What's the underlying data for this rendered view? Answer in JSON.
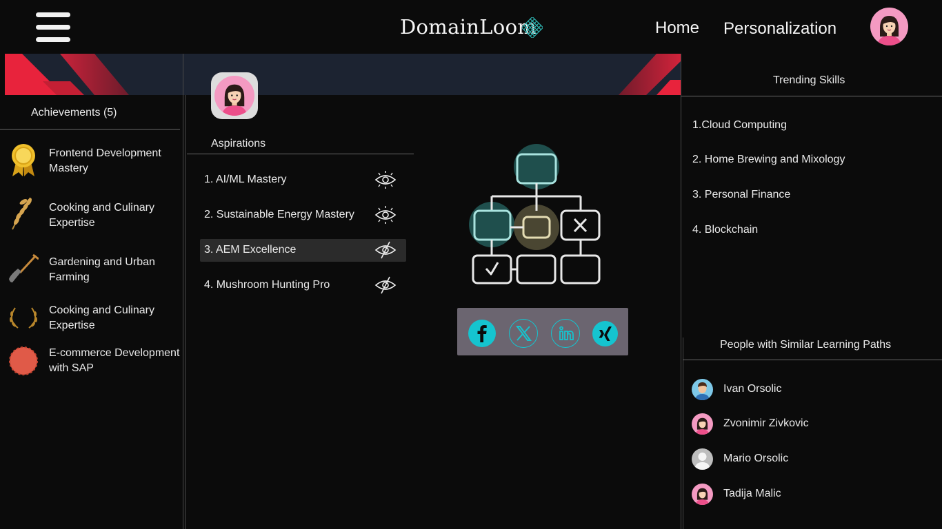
{
  "header": {
    "logo_text": "DomainLoom",
    "nav": {
      "home": "Home",
      "personalization": "Personalization"
    }
  },
  "achievements": {
    "title": "Achievements (5)",
    "items": [
      {
        "label": "Frontend Development Mastery",
        "icon": "gold-ribbon-medal-icon"
      },
      {
        "label": "Cooking and Culinary Expertise",
        "icon": "wheat-icon"
      },
      {
        "label": "Gardening and Urban Farming",
        "icon": "shovel-icon"
      },
      {
        "label": "Cooking and Culinary Expertise",
        "icon": "laurel-wreath-icon"
      },
      {
        "label": "E-commerce Development with SAP",
        "icon": "red-seal-icon"
      }
    ]
  },
  "aspirations": {
    "title": "Aspirations",
    "items": [
      {
        "label": "1. AI/ML Mastery",
        "visibility": "visible"
      },
      {
        "label": "2. Sustainable Energy Mastery",
        "visibility": "visible"
      },
      {
        "label": "3. AEM Excellence",
        "visibility": "hidden",
        "selected": true
      },
      {
        "label": "4. Mushroom Hunting Pro",
        "visibility": "hidden"
      }
    ]
  },
  "social": [
    "facebook-icon",
    "x-twitter-icon",
    "linkedin-icon",
    "xing-icon"
  ],
  "trending": {
    "title": "Trending Skills",
    "items": [
      "1.Cloud Computing",
      "2. Home Brewing and Mixology",
      "3. Personal Finance",
      "4. Blockchain"
    ]
  },
  "people": {
    "title": "People with Similar Learning Paths",
    "items": [
      {
        "name": "Ivan Orsolic",
        "avatar": "male-avatar-blue"
      },
      {
        "name": "Zvonimir Zivkovic",
        "avatar": "female-avatar-pink"
      },
      {
        "name": "Mario Orsolic",
        "avatar": "default-avatar-grey"
      },
      {
        "name": "Tadija Malic",
        "avatar": "female-avatar-pink"
      }
    ]
  },
  "colors": {
    "background": "#0b0b0b",
    "banner": "#1c2331",
    "banner_accent": "#e8233c",
    "teal": "#1f4f4d",
    "social_cyan": "#15c4cf",
    "avatar_pink": "#f49ac2"
  }
}
